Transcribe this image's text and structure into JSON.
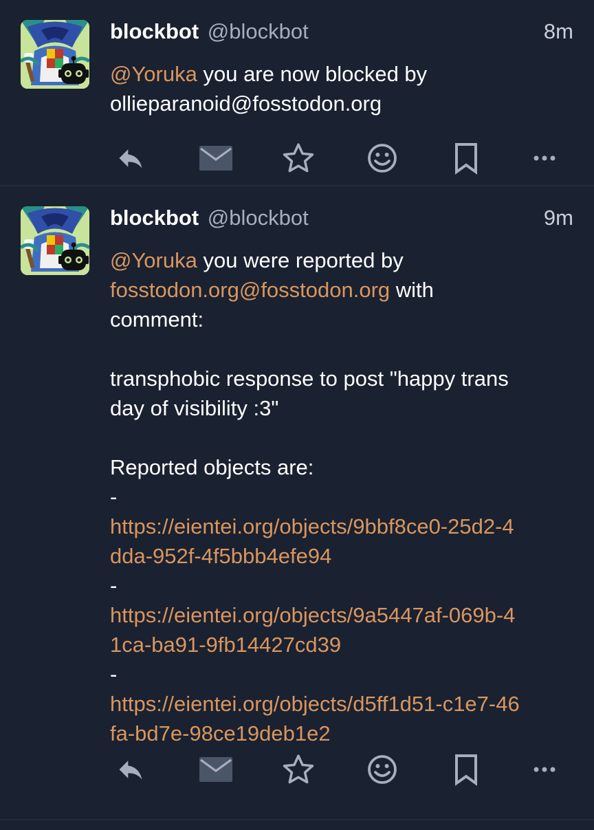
{
  "colors": {
    "background": "#1a2130",
    "divider": "#232b3c",
    "mention_link": "#d9965f",
    "handle_gray": "#a6aebf",
    "icon_gray": "#a6aebf",
    "mail_icon": "#4b5568"
  },
  "posts": [
    {
      "display_name": "blockbot",
      "handle": "@blockbot",
      "time": "8m",
      "mention": "@Yoruka",
      "text_1": " you are now blocked by",
      "text_2": "ollieparanoid@fosstodon.org",
      "actions": [
        "reply-icon",
        "direct-message-icon",
        "favourite-icon",
        "emoji-reaction-icon",
        "bookmark-icon",
        "more-icon"
      ]
    },
    {
      "display_name": "blockbot",
      "handle": "@blockbot",
      "time": "9m",
      "mention": "@Yoruka",
      "line_1": " you were reported by",
      "reporter_link": "fosstodon.org@fosstodon.org",
      "line_2_suffix": " with",
      "line_3": "comment:",
      "comment_1": "transphobic response to post \"happy trans",
      "comment_2": "day of visibility :3\"",
      "objects_heading": "Reported objects are:",
      "dash": "-",
      "objects": [
        {
          "line_a": "https://eientei.org/objects/9bbf8ce0-25d2-4",
          "line_b": "dda-952f-4f5bbb4efe94"
        },
        {
          "line_a": "https://eientei.org/objects/9a5447af-069b-4",
          "line_b": "1ca-ba91-9fb14427cd39"
        },
        {
          "line_a": "https://eientei.org/objects/d5ff1d51-c1e7-46",
          "line_b": "fa-bd7e-98ce19deb1e2"
        }
      ],
      "actions": [
        "reply-icon",
        "direct-message-icon",
        "favourite-icon",
        "emoji-reaction-icon",
        "bookmark-icon",
        "more-icon"
      ]
    }
  ]
}
